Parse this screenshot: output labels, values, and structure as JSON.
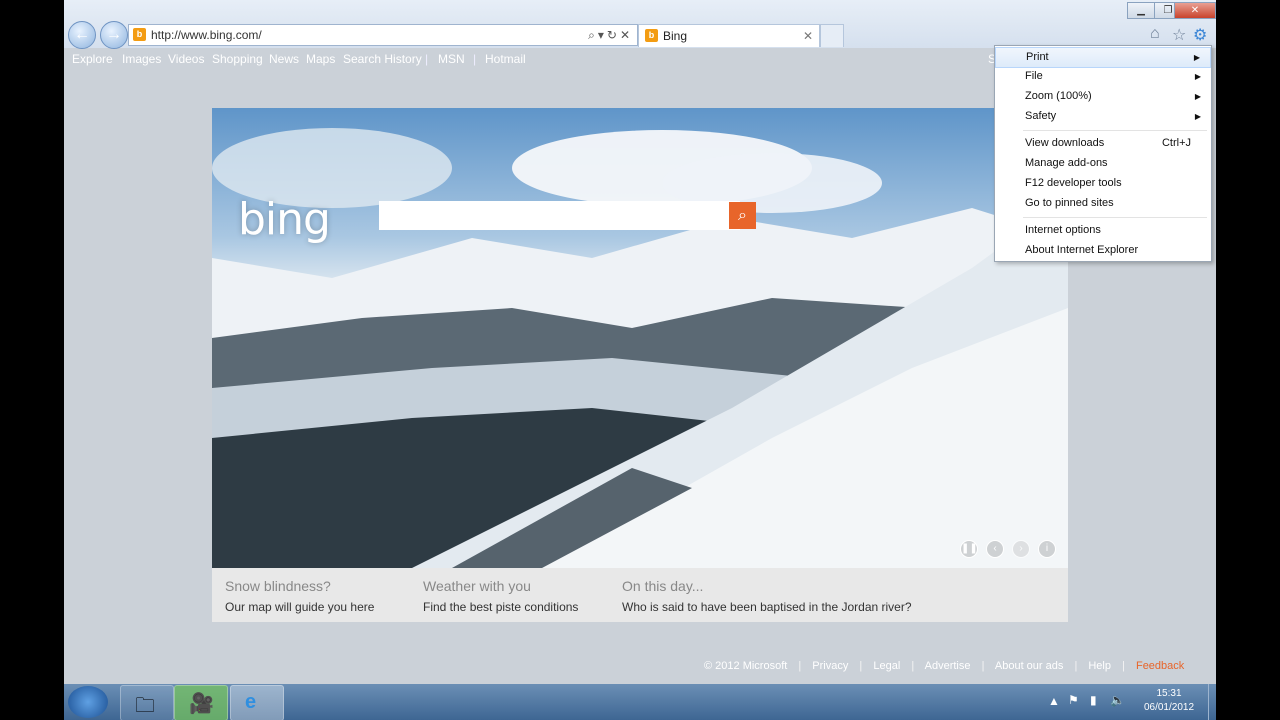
{
  "browser": {
    "url": "http://www.bing.com/",
    "tab_title": "Bing",
    "window_controls": {
      "minimize": "▁",
      "maximize": "❐",
      "close": "✕"
    }
  },
  "bing_nav": {
    "items": [
      "Explore",
      "Images",
      "Videos",
      "Shopping",
      "News",
      "Maps",
      "Search History",
      "MSN",
      "Hotmail"
    ],
    "separator": "|",
    "right_partial": "S"
  },
  "bing": {
    "logo_text": "bing",
    "search_value": ""
  },
  "tiles": [
    {
      "title": "Snow blindness?",
      "subtitle": "Our map will guide you here"
    },
    {
      "title": "Weather with you",
      "subtitle": "Find the best piste conditions"
    },
    {
      "title": "On this day...",
      "subtitle": "Who is said to have been baptised in the Jordan river?"
    }
  ],
  "footer": {
    "copyright": "© 2012 Microsoft",
    "links": [
      "Privacy",
      "Legal",
      "Advertise",
      "About our ads",
      "Help",
      "Feedback"
    ]
  },
  "tools_menu": {
    "items": [
      {
        "label": "Print",
        "submenu": true
      },
      {
        "label": "File",
        "submenu": true
      },
      {
        "label": "Zoom (100%)",
        "submenu": true
      },
      {
        "label": "Safety",
        "submenu": true
      },
      {
        "label": "View downloads",
        "shortcut": "Ctrl+J"
      },
      {
        "label": "Manage add-ons"
      },
      {
        "label": "F12 developer tools"
      },
      {
        "label": "Go to pinned sites"
      },
      {
        "label": "Internet options"
      },
      {
        "label": "About Internet Explorer"
      }
    ],
    "highlighted": "Print"
  },
  "taskbar": {
    "time": "15:31",
    "date": "06/01/2012"
  },
  "colors": {
    "accent": "#e8652a",
    "page_bg": "#cbd1d8",
    "menu_highlight": "#deebfa"
  }
}
